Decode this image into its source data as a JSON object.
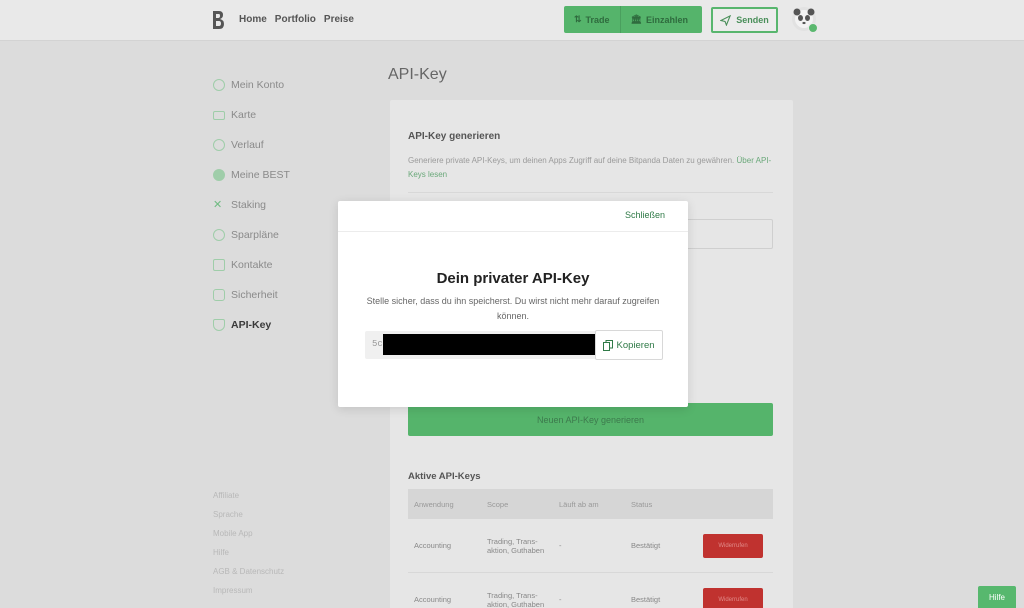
{
  "header": {
    "nav": [
      "Home",
      "Portfolio",
      "Preise"
    ],
    "trade_label": "Trade",
    "deposit_label": "Einzahlen",
    "send_label": "Senden"
  },
  "sidebar": {
    "items": [
      "Mein Konto",
      "Karte",
      "Verlauf",
      "Meine BEST",
      "Staking",
      "Sparpläne",
      "Kontakte",
      "Sicherheit",
      "API-Key"
    ],
    "active": "API-Key",
    "footer": [
      "Affiliate",
      "Sprache",
      "Mobile App",
      "Hilfe",
      "AGB & Datenschutz",
      "Impressum"
    ]
  },
  "main": {
    "title": "API-Key",
    "section_title": "API-Key generieren",
    "description": "Generiere private API-Keys, um deinen Apps Zugriff auf deine Bitpanda Daten zu gewähren.",
    "description_link": "Über API-Keys lesen",
    "generate_button": "Neuen API-Key generieren",
    "active_keys_title": "Aktive API-Keys",
    "table": {
      "headers": [
        "Anwendung",
        "Scope",
        "Läuft ab am",
        "Status",
        ""
      ],
      "rows": [
        [
          "Accounting",
          "Trading, Trans- aktion, Guthaben",
          "-",
          "Bestätigt",
          "Widerrufen"
        ],
        [
          "Accounting",
          "Trading, Trans- aktion, Guthaben",
          "-",
          "Bestätigt",
          "Widerrufen"
        ]
      ]
    }
  },
  "modal": {
    "close_label": "Schließen",
    "title": "Dein privater API-Key",
    "subtitle": "Stelle sicher, dass du ihn speicherst. Du wirst nicht mehr darauf zugreifen können.",
    "key_prefix": "5c",
    "copy_label": "Kopieren"
  },
  "help_label": "Hilfe",
  "colors": {
    "accent": "#2f7a47",
    "primary_green": "#55b46b",
    "danger": "#c0322f"
  }
}
